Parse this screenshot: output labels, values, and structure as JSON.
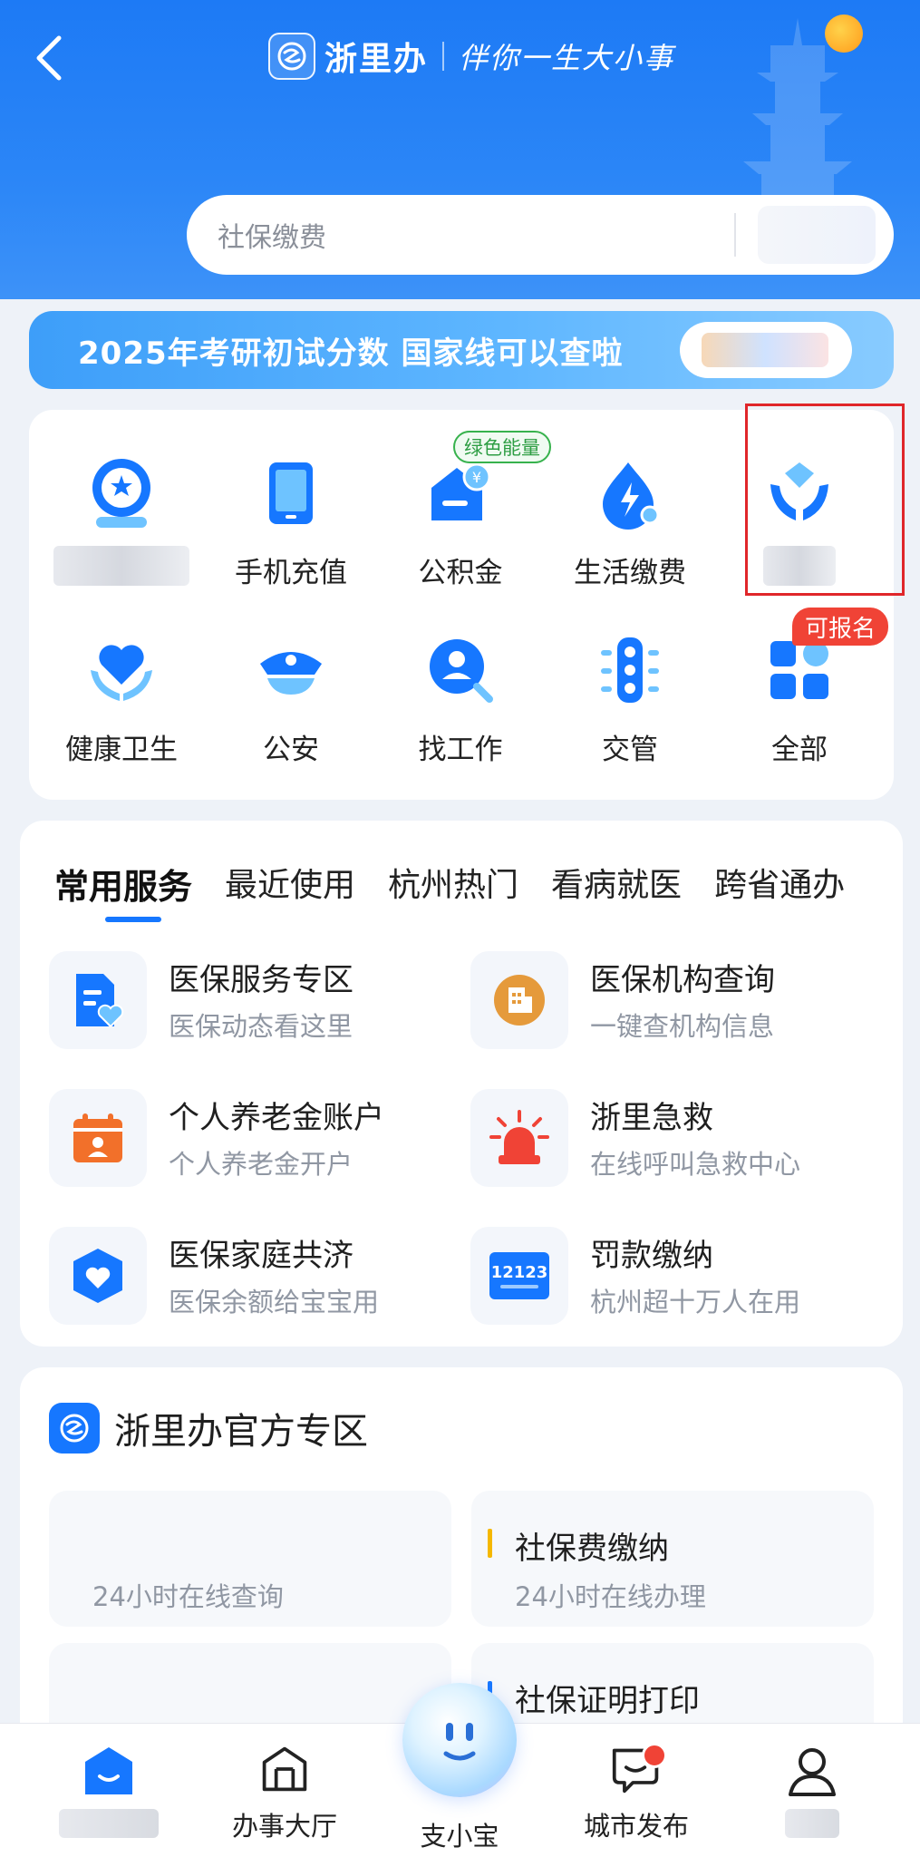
{
  "header": {
    "brand_name": "浙里办",
    "slogan": "伴你一生大小事",
    "search_placeholder": "社保缴费"
  },
  "banner": {
    "text": "2025年考研初试分数 国家线可以查啦"
  },
  "quick_grid": {
    "items": [
      {
        "label": "",
        "icon": "globe-badge-icon",
        "blurred": true
      },
      {
        "label": "手机充值",
        "icon": "phone-icon"
      },
      {
        "label": "公积金",
        "icon": "housing-fund-icon"
      },
      {
        "label": "生活缴费",
        "icon": "water-drop-bolt-icon"
      },
      {
        "label": "",
        "icon": "hands-diamond-icon",
        "blurred": true
      },
      {
        "label": "健康卫生",
        "icon": "heart-hands-icon"
      },
      {
        "label": "公安",
        "icon": "police-cap-icon"
      },
      {
        "label": "找工作",
        "icon": "job-search-icon"
      },
      {
        "label": "交管",
        "icon": "traffic-light-icon"
      },
      {
        "label": "全部",
        "icon": "grid-icon"
      }
    ],
    "green_tag": "绿色能量",
    "red_tag": "可报名"
  },
  "services": {
    "tabs": [
      "常用服务",
      "最近使用",
      "杭州热门",
      "看病就医",
      "跨省通办"
    ],
    "items": [
      {
        "title": "医保服务专区",
        "sub": "医保动态看这里",
        "icon": "medical-doc-icon"
      },
      {
        "title": "医保机构查询",
        "sub": "一键查机构信息",
        "icon": "building-icon"
      },
      {
        "title": "个人养老金账户",
        "sub": "个人养老金开户",
        "icon": "calendar-person-icon"
      },
      {
        "title": "浙里急救",
        "sub": "在线呼叫急救中心",
        "icon": "alarm-light-icon"
      },
      {
        "title": "医保家庭共济",
        "sub": "医保余额给宝宝用",
        "icon": "shield-heart-icon"
      },
      {
        "title": "罚款缴纳",
        "sub": "杭州超十万人在用",
        "icon": "12123-icon"
      }
    ],
    "icon_12123_text": "12123"
  },
  "official": {
    "title": "浙里办官方专区",
    "cards": [
      {
        "title": "",
        "sub": "24小时在线查询"
      },
      {
        "title": "社保费缴纳",
        "sub": "24小时在线办理"
      },
      {
        "title": "",
        "sub": ""
      },
      {
        "title": "社保证明打印",
        "sub": ""
      }
    ]
  },
  "bottom_nav": {
    "items": [
      {
        "label": "",
        "icon": "home-icon",
        "blurred": true
      },
      {
        "label": "办事大厅",
        "icon": "hall-icon"
      },
      {
        "label": "支小宝",
        "icon": "assistant-orb"
      },
      {
        "label": "城市发布",
        "icon": "message-icon"
      },
      {
        "label": "",
        "icon": "profile-icon",
        "blurred": true
      }
    ]
  },
  "colors": {
    "primary": "#1677ff",
    "header_top": "#1d7af5",
    "badge_red": "#f04336",
    "green": "#37b24d"
  }
}
